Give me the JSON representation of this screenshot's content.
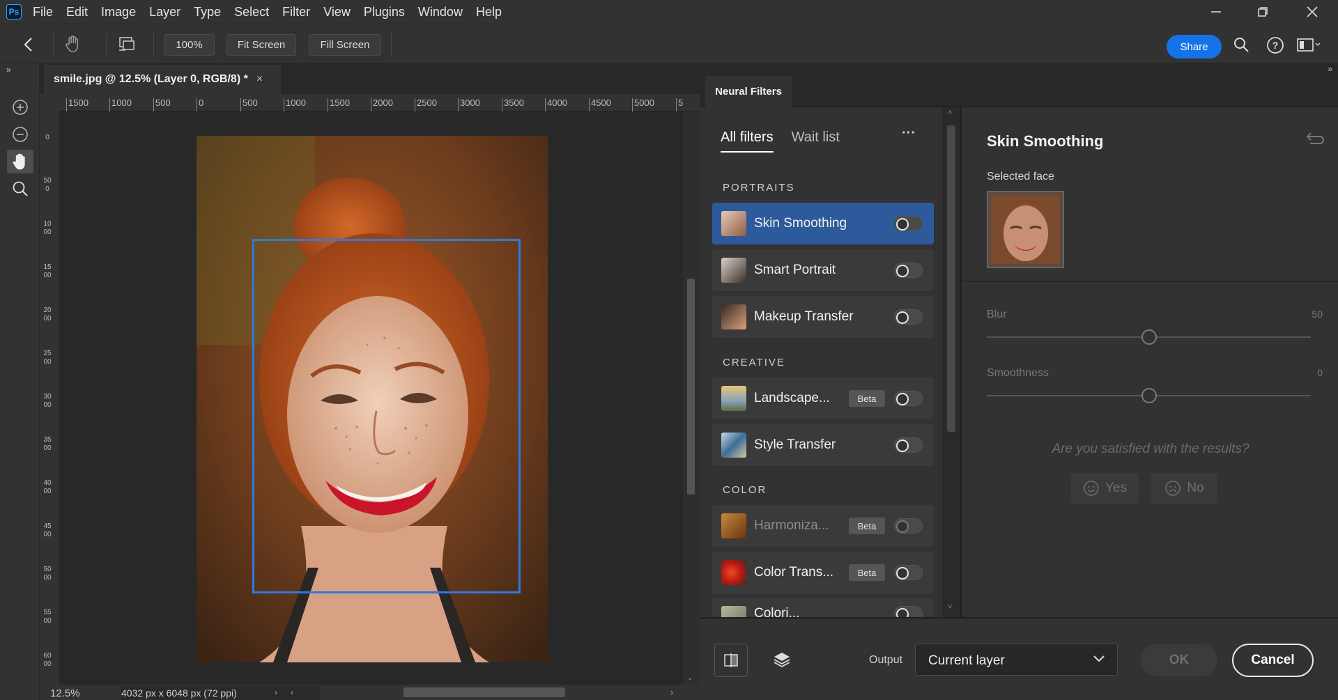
{
  "app": {
    "logo": "Ps"
  },
  "menu": [
    "File",
    "Edit",
    "Image",
    "Layer",
    "Type",
    "Select",
    "Filter",
    "View",
    "Plugins",
    "Window",
    "Help"
  ],
  "options": {
    "zoom": "100%",
    "fit_screen": "Fit Screen",
    "fill_screen": "Fill Screen",
    "share": "Share"
  },
  "document": {
    "tab_title": "smile.jpg @ 12.5% (Layer 0, RGB/8) *",
    "close": "×",
    "ruler_h": [
      "1500",
      "1000",
      "500",
      "0",
      "500",
      "1000",
      "1500",
      "2000",
      "2500",
      "3000",
      "3500",
      "4000",
      "4500",
      "5000",
      "5"
    ],
    "ruler_v": [
      "0",
      "500",
      "1000",
      "1500",
      "2000",
      "2500",
      "3000",
      "3500",
      "4000",
      "4500",
      "5000",
      "5500",
      "6000"
    ],
    "zoom_status": "12.5%",
    "dimensions": "4032 px x 6048 px (72 ppi)"
  },
  "neural_filters": {
    "panel_tab": "Neural Filters",
    "tabs": [
      {
        "label": "All filters",
        "active": true
      },
      {
        "label": "Wait list",
        "active": false
      }
    ],
    "more": "···",
    "sections": [
      {
        "title": "PORTRAITS",
        "filters": [
          {
            "label": "Skin Smoothing",
            "beta": false,
            "selected": true,
            "enabled": false
          },
          {
            "label": "Smart Portrait",
            "beta": false,
            "selected": false,
            "enabled": false
          },
          {
            "label": "Makeup Transfer",
            "beta": false,
            "selected": false,
            "enabled": false
          }
        ]
      },
      {
        "title": "CREATIVE",
        "filters": [
          {
            "label": "Landscape...",
            "beta": true,
            "selected": false,
            "enabled": false
          },
          {
            "label": "Style Transfer",
            "beta": false,
            "selected": false,
            "enabled": false
          }
        ]
      },
      {
        "title": "COLOR",
        "filters": [
          {
            "label": "Harmoniza...",
            "beta": true,
            "selected": false,
            "enabled": false,
            "dim": true
          },
          {
            "label": "Color Trans...",
            "beta": true,
            "selected": false,
            "enabled": false
          },
          {
            "label": "Colori...",
            "beta": false,
            "selected": false,
            "enabled": false
          }
        ]
      }
    ],
    "beta_label": "Beta",
    "settings": {
      "title": "Skin Smoothing",
      "selected_face": "Selected face",
      "blur": {
        "label": "Blur",
        "value": "50",
        "level": 0.5
      },
      "smoothness": {
        "label": "Smoothness",
        "value": "0",
        "level": 0.5
      },
      "feedback_question": "Are you satisfied with the results?",
      "yes": "Yes",
      "no": "No"
    },
    "footer": {
      "output_label": "Output",
      "output_value": "Current layer",
      "ok": "OK",
      "cancel": "Cancel"
    }
  }
}
